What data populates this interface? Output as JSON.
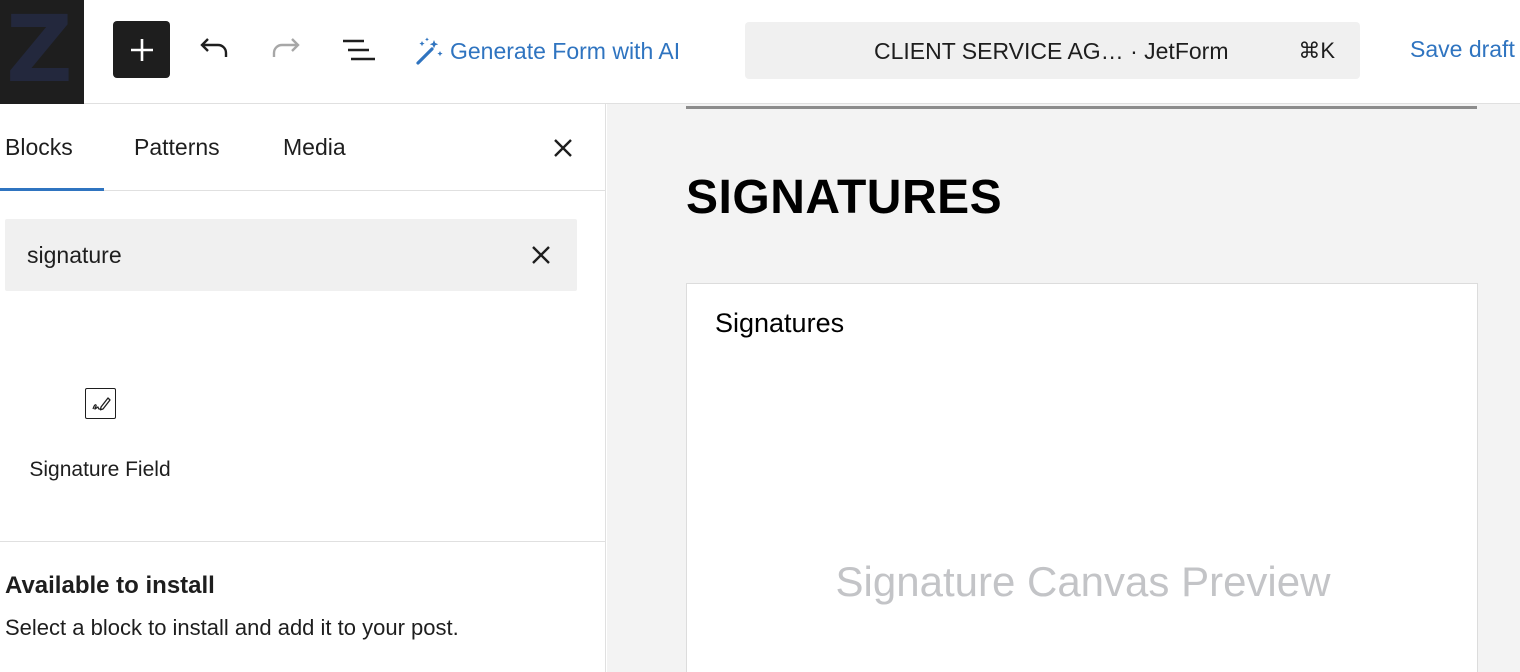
{
  "header": {
    "site_logo_letter": "Z",
    "add_block_label": "Toggle block inserter",
    "generate_ai_label": "Generate Form with AI",
    "command_bar": {
      "doc_title": "CLIENT SERVICE AG…",
      "separator": " · ",
      "post_type": "JetForm",
      "shortcut": "⌘K"
    },
    "save_draft_label": "Save draft"
  },
  "inserter": {
    "tabs": [
      {
        "label": "Blocks",
        "active": true
      },
      {
        "label": "Patterns",
        "active": false
      },
      {
        "label": "Media",
        "active": false
      }
    ],
    "search": {
      "value": "signature",
      "placeholder": "Search"
    },
    "results": [
      {
        "label": "Signature Field",
        "icon": "signature-icon"
      }
    ],
    "install_section": {
      "title": "Available to install",
      "description": "Select a block to install and add it to your post."
    }
  },
  "canvas": {
    "heading": "SIGNATURES",
    "signature_block": {
      "label": "Signatures",
      "preview_text": "Signature Canvas Preview"
    }
  },
  "colors": {
    "accent": "#2f74c0",
    "dark": "#1e1e1e",
    "canvas_bg": "#f3f3f3",
    "search_bg": "#f0f0f0",
    "placeholder_text": "#c3c4c7"
  }
}
